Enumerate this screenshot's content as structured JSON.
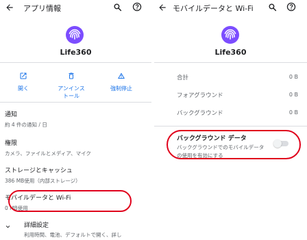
{
  "left": {
    "title": "アプリ情報",
    "app_name": "Life360",
    "actions": [
      {
        "label": "開く",
        "icon": "open-in-new-icon"
      },
      {
        "label": "アンインストール",
        "icon": "trash-icon"
      },
      {
        "label": "強制停止",
        "icon": "warning-icon"
      }
    ],
    "settings": [
      {
        "title": "通知",
        "subtitle": "約 4 件の通知 / 日"
      },
      {
        "title": "権限",
        "subtitle": "カメラ、ファイルとメディア、マイク"
      },
      {
        "title": "ストレージとキャッシュ",
        "subtitle": "386 MB使用（内部ストレージ）"
      },
      {
        "title": "モバイルデータと Wi-Fi",
        "subtitle": "0 MB使用"
      },
      {
        "title": "詳細設定",
        "subtitle": "利用時間、電池、デフォルトで開く、詳し"
      }
    ]
  },
  "right": {
    "title": "モバイルデータと Wi-Fi",
    "app_name": "Life360",
    "stats": [
      {
        "label": "合計",
        "value": "0 B"
      },
      {
        "label": "フォアグラウンド",
        "value": "0 B"
      },
      {
        "label": "バックグラウンド",
        "value": "0 B"
      }
    ],
    "background_toggle": {
      "title": "バックグラウンド データ",
      "subtitle_line1": "バックグラウンドでのモバイルデータ",
      "subtitle_line2": "の使用を有効にする",
      "enabled": false
    }
  },
  "colors": {
    "accent": "#1a73e8",
    "app_icon": "#7c4dff",
    "highlight": "#e0001b"
  }
}
